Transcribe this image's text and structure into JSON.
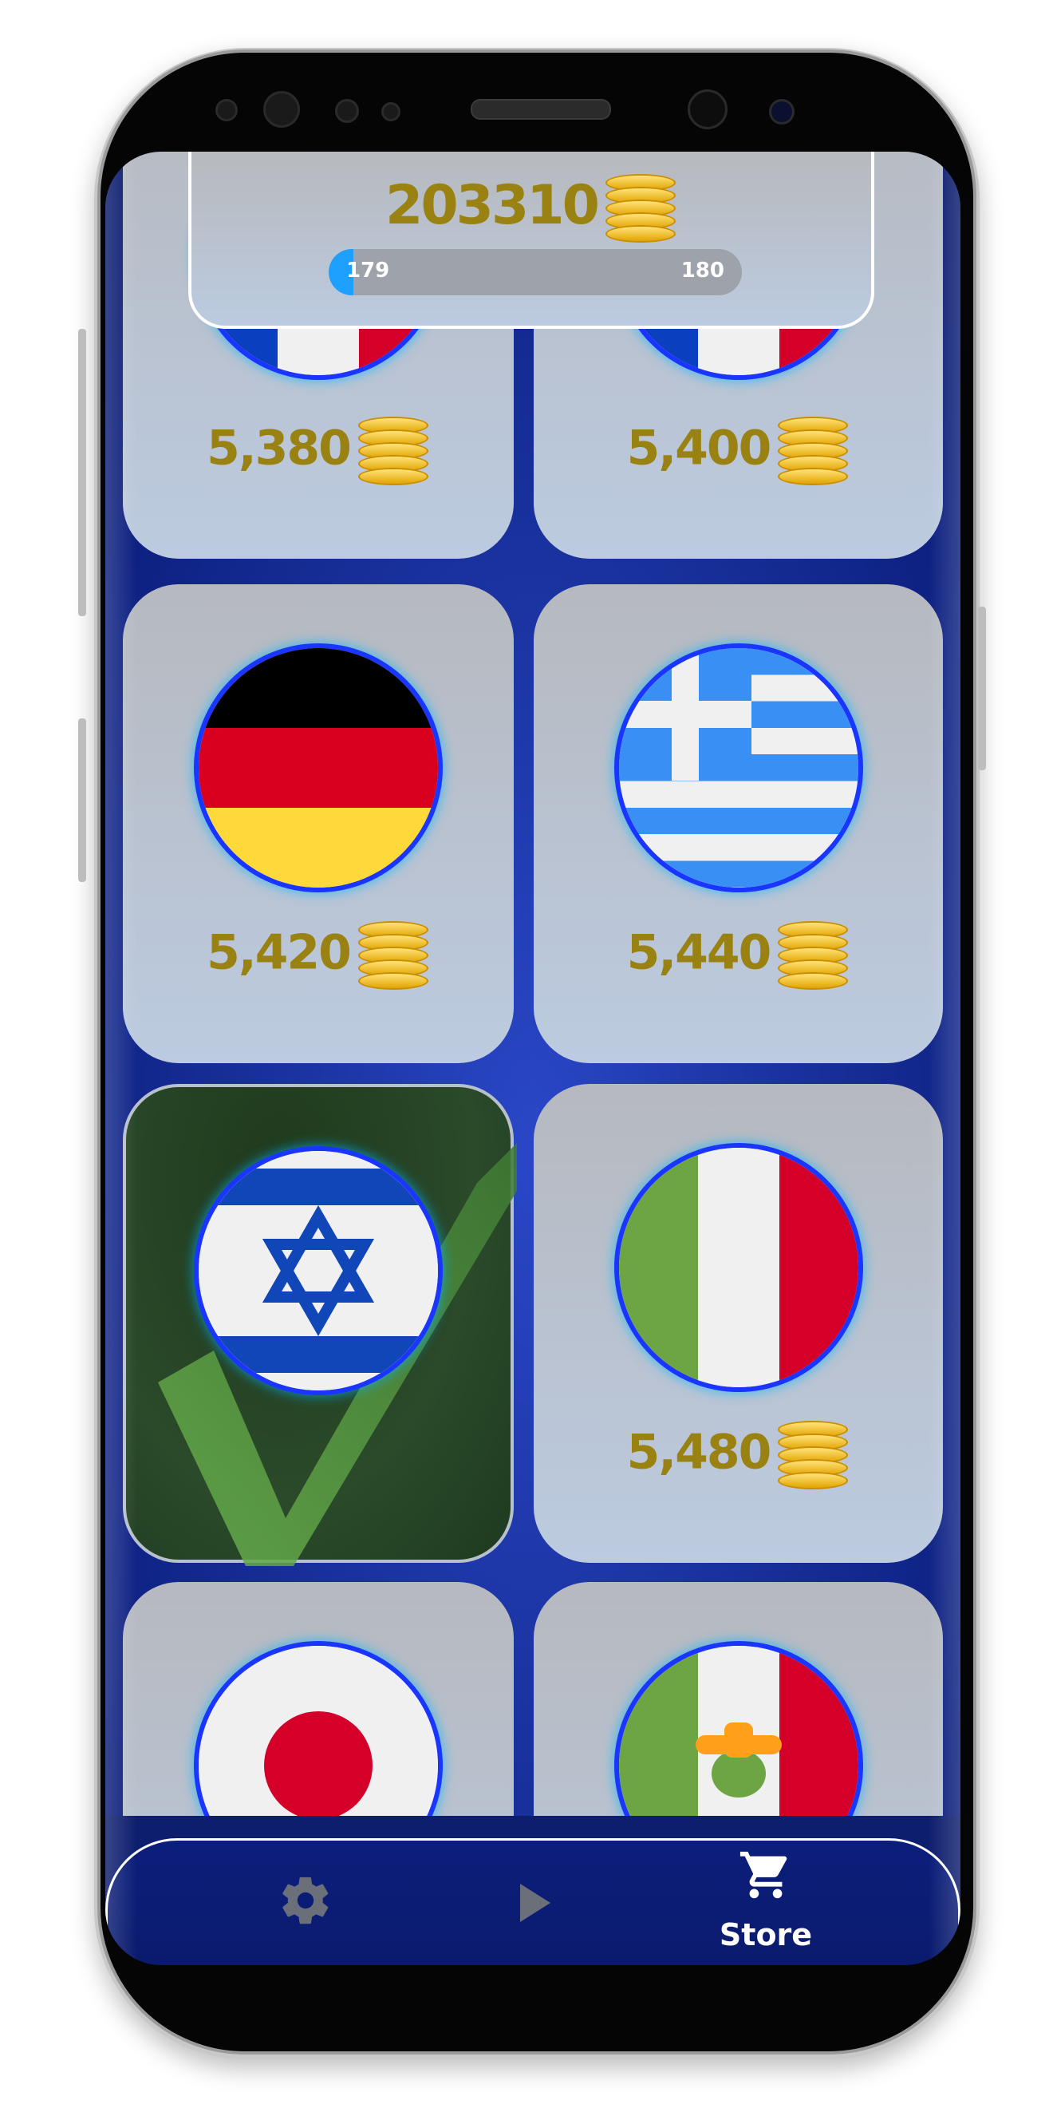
{
  "header": {
    "coin_total": "203310",
    "level_current": "179",
    "level_next": "180",
    "progress_fraction": 0.06
  },
  "cards": [
    {
      "name": "france",
      "price": "5,380",
      "status": "locked"
    },
    {
      "name": "france-2",
      "price": "5,400",
      "status": "locked"
    },
    {
      "name": "germany",
      "price": "5,420",
      "status": "locked"
    },
    {
      "name": "greece",
      "price": "5,440",
      "status": "locked"
    },
    {
      "name": "israel",
      "price": "",
      "status": "owned"
    },
    {
      "name": "italy",
      "price": "5,480",
      "status": "locked"
    },
    {
      "name": "japan",
      "price": "",
      "status": "locked"
    },
    {
      "name": "mexico",
      "price": "",
      "status": "locked"
    }
  ],
  "nav": {
    "settings_icon": "gear-icon",
    "play_icon": "play-icon",
    "store_icon": "cart-icon",
    "store_label": "Store"
  },
  "colors": {
    "price_gold": "#9a8212",
    "background_blue": "#1a33a0",
    "progress_blue": "#1ea0ff"
  }
}
